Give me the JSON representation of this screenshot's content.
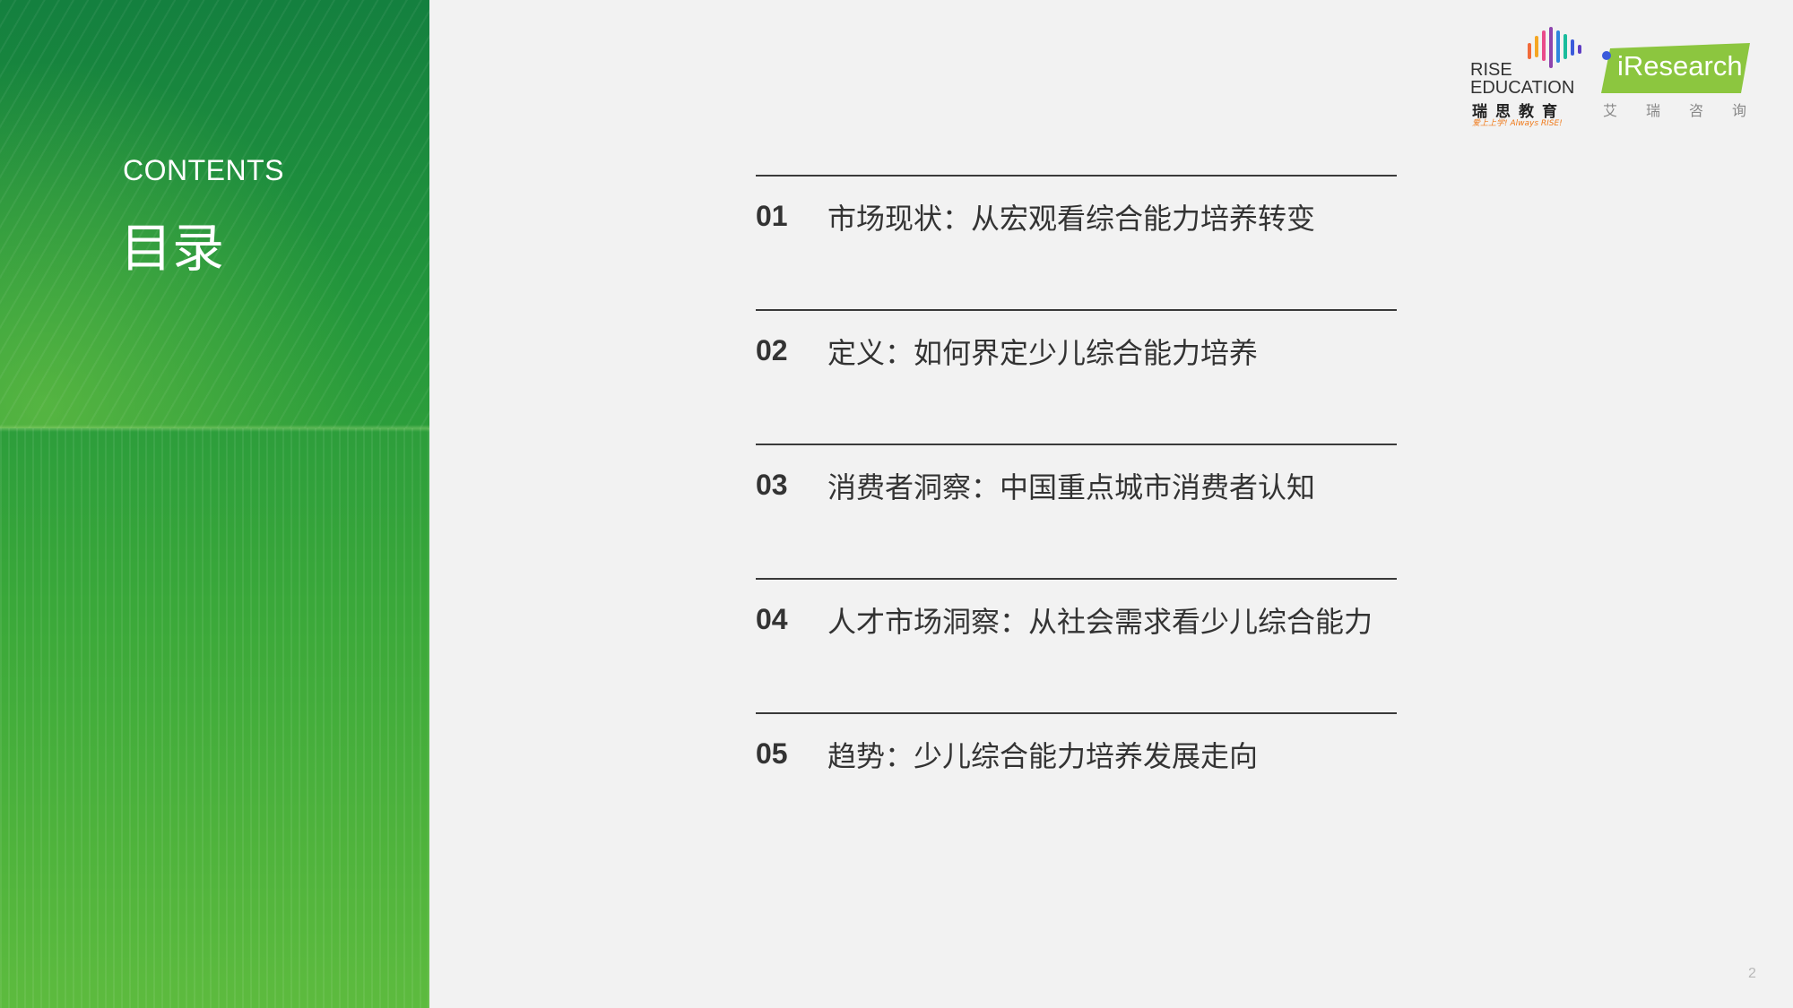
{
  "sidebar": {
    "contents_en": "CONTENTS",
    "contents_zh": "目录"
  },
  "logos": {
    "rise": {
      "line1": "RISE",
      "line2": "EDUCATION",
      "chinese": "瑞思教育",
      "slogan": "爱上上学! Always RISE!"
    },
    "iresearch": {
      "name": "iResearch",
      "chinese": "艾瑞咨询",
      "badge_color": "#8cc63f"
    }
  },
  "toc": {
    "items": [
      {
        "num": "01",
        "title": "市场现状：从宏观看综合能力培养转变"
      },
      {
        "num": "02",
        "title": "定义：如何界定少儿综合能力培养"
      },
      {
        "num": "03",
        "title": "消费者洞察：中国重点城市消费者认知"
      },
      {
        "num": "04",
        "title": "人才市场洞察：从社会需求看少儿综合能力"
      },
      {
        "num": "05",
        "title": "趋势：少儿综合能力培养发展走向"
      }
    ]
  },
  "page_number": "2",
  "colors": {
    "panel_top": "#14803f",
    "panel_bottom": "#5dbb3e",
    "background": "#f2f2f2",
    "text": "#333333"
  }
}
